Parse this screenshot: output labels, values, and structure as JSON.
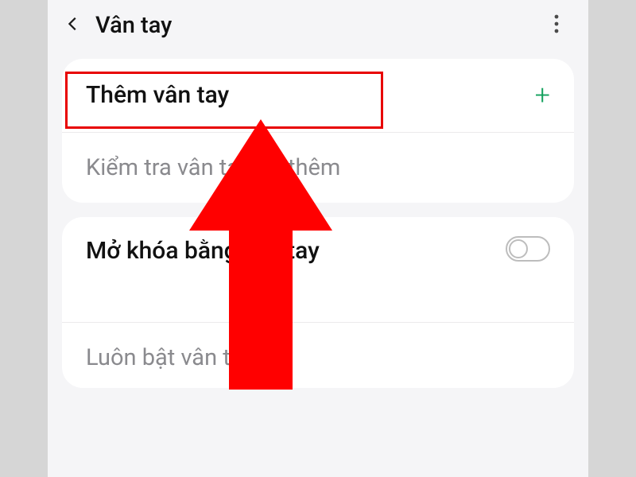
{
  "header": {
    "title": "Vân tay"
  },
  "card1": {
    "add": {
      "label": "Thêm vân tay"
    },
    "check": {
      "label": "Kiểm tra vân tay đã thêm"
    }
  },
  "card2": {
    "unlock": {
      "label": "Mở khóa bằng vân tay",
      "enabled": false
    },
    "always": {
      "label": "Luôn bật vân tay"
    }
  },
  "icons": {
    "back": "chevron-left",
    "more": "more-vertical",
    "plus": "+"
  },
  "annotation": {
    "highlight_target": "add-fingerprint-row",
    "arrow_color": "#ff0000"
  }
}
